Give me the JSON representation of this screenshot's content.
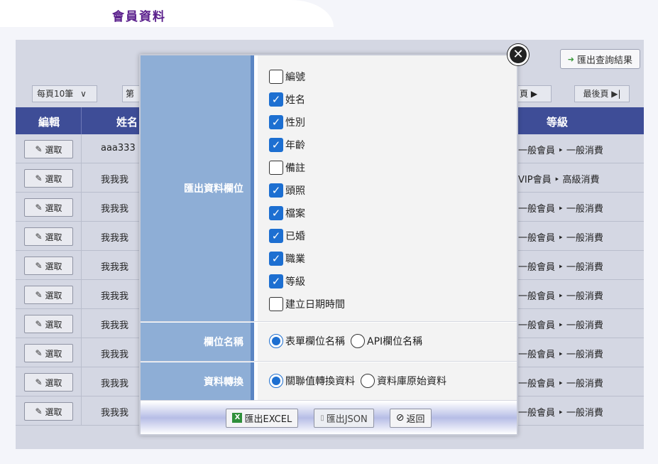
{
  "page": {
    "title": "會員資料"
  },
  "toolbar": {
    "export_result_label": "匯出查詢結果",
    "export_result_icon": "export-arrow-icon"
  },
  "pager": {
    "per_page": "每頁10筆",
    "per_page_arrow": "∨",
    "first": "第",
    "next": "頁 ▶",
    "last": "最後頁 ▶|"
  },
  "grid": {
    "headers": {
      "edit": "編輯",
      "name": "姓名",
      "level": "等級"
    },
    "select_label": "選取",
    "rows": [
      {
        "name": "aaa333",
        "level": "一般會員 ‣ 一般消費"
      },
      {
        "name": "我我我",
        "level": "VIP會員 ‣ 高級消費"
      },
      {
        "name": "我我我",
        "level": "一般會員 ‣ 一般消費"
      },
      {
        "name": "我我我",
        "level": "一般會員 ‣ 一般消費"
      },
      {
        "name": "我我我",
        "level": "一般會員 ‣ 一般消費"
      },
      {
        "name": "我我我",
        "level": "一般會員 ‣ 一般消費"
      },
      {
        "name": "我我我",
        "level": "一般會員 ‣ 一般消費"
      },
      {
        "name": "我我我",
        "level": "一般會員 ‣ 一般消費"
      },
      {
        "name": "我我我",
        "level": "一般會員 ‣ 一般消費"
      },
      {
        "name": "我我我",
        "level": "一般會員 ‣ 一般消費"
      }
    ]
  },
  "dialog": {
    "fields_label": "匯出資料欄位",
    "fields": [
      {
        "label": "編號",
        "checked": false
      },
      {
        "label": "姓名",
        "checked": true
      },
      {
        "label": "性別",
        "checked": true
      },
      {
        "label": "年齡",
        "checked": true
      },
      {
        "label": "備註",
        "checked": false
      },
      {
        "label": "頭照",
        "checked": true
      },
      {
        "label": "檔案",
        "checked": true
      },
      {
        "label": "已婚",
        "checked": true
      },
      {
        "label": "職業",
        "checked": true
      },
      {
        "label": "等級",
        "checked": true
      },
      {
        "label": "建立日期時間",
        "checked": false
      }
    ],
    "names_label": "欄位名稱",
    "names_option_1": "表單欄位名稱",
    "names_option_2": "API欄位名稱",
    "convert_label": "資料轉換",
    "convert_option_1": "關聯值轉換資料",
    "convert_option_2": "資料庫原始資料",
    "btn_excel": "匯出EXCEL",
    "btn_json": "匯出JSON",
    "btn_back": "返回",
    "close_symbol": "✕"
  },
  "colors": {
    "accent": "#1d6fd1",
    "header_bg": "#3e4d97",
    "label_bg": "#8eaed6",
    "title": "#5a1f8c"
  }
}
